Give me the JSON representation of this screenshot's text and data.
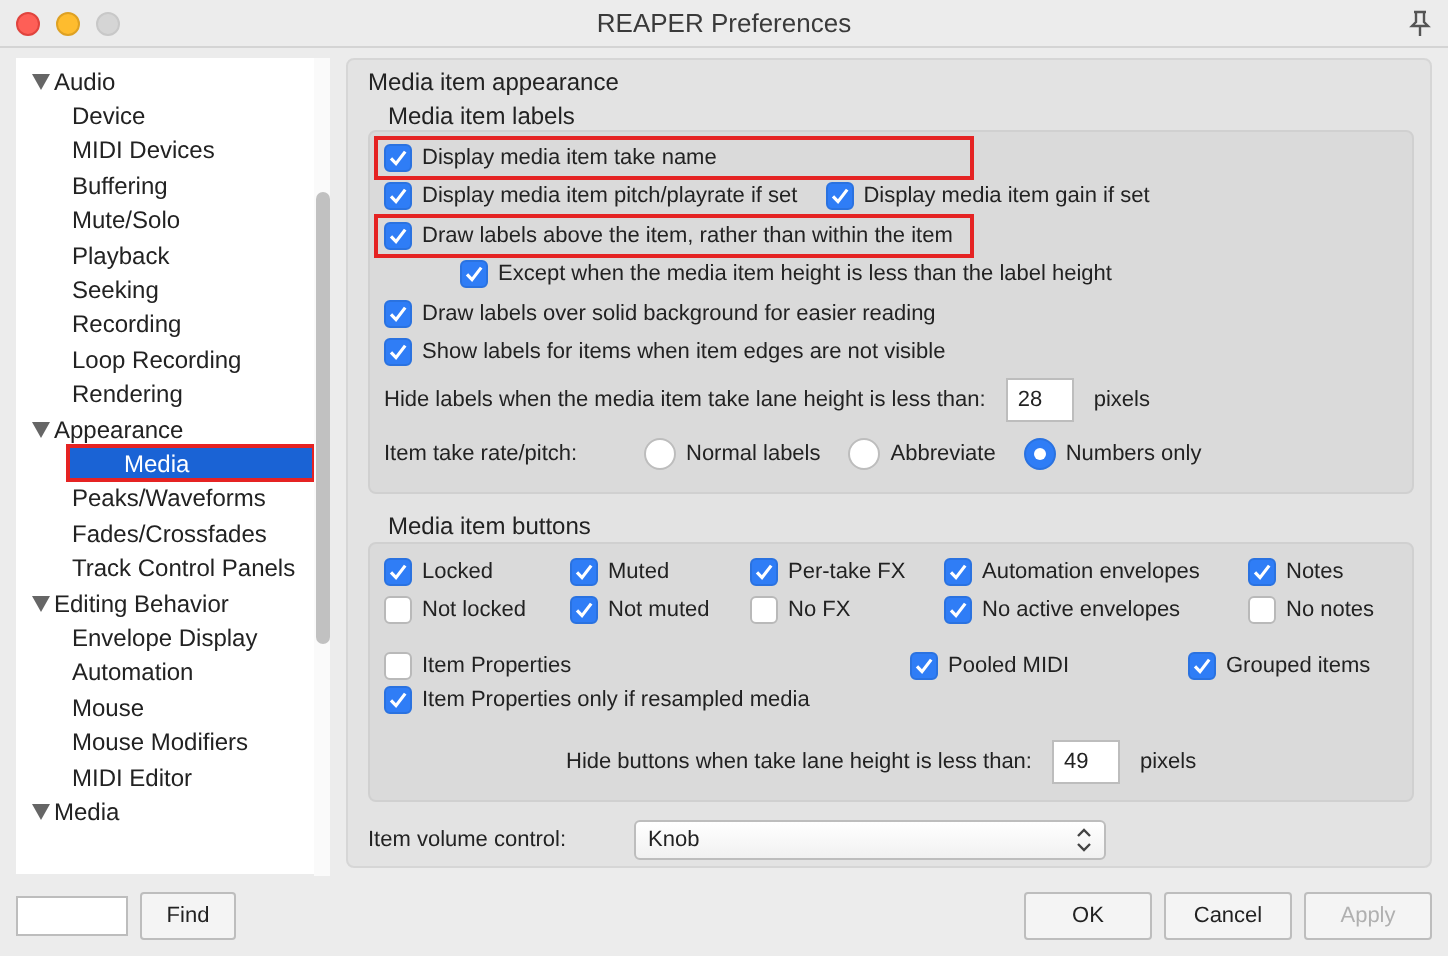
{
  "window": {
    "title": "REAPER Preferences"
  },
  "sidebar": {
    "items": [
      {
        "label": "Audio",
        "expanded": true,
        "selected": false,
        "highlighted": false,
        "children": [
          {
            "label": "Device",
            "selected": false,
            "highlighted": false
          },
          {
            "label": "MIDI Devices",
            "selected": false,
            "highlighted": false
          },
          {
            "label": "Buffering",
            "selected": false,
            "highlighted": false
          },
          {
            "label": "Mute/Solo",
            "selected": false,
            "highlighted": false
          },
          {
            "label": "Playback",
            "selected": false,
            "highlighted": false
          },
          {
            "label": "Seeking",
            "selected": false,
            "highlighted": false
          },
          {
            "label": "Recording",
            "selected": false,
            "highlighted": false
          },
          {
            "label": "Loop Recording",
            "selected": false,
            "highlighted": false
          },
          {
            "label": "Rendering",
            "selected": false,
            "highlighted": false
          }
        ]
      },
      {
        "label": "Appearance",
        "expanded": true,
        "selected": false,
        "highlighted": false,
        "children": [
          {
            "label": "Media",
            "selected": true,
            "highlighted": true
          },
          {
            "label": "Peaks/Waveforms",
            "selected": false,
            "highlighted": false
          },
          {
            "label": "Fades/Crossfades",
            "selected": false,
            "highlighted": false
          },
          {
            "label": "Track Control Panels",
            "selected": false,
            "highlighted": false
          }
        ]
      },
      {
        "label": "Editing Behavior",
        "expanded": true,
        "selected": false,
        "highlighted": false,
        "children": [
          {
            "label": "Envelope Display",
            "selected": false,
            "highlighted": false
          },
          {
            "label": "Automation",
            "selected": false,
            "highlighted": false
          },
          {
            "label": "Mouse",
            "selected": false,
            "highlighted": false
          },
          {
            "label": "Mouse Modifiers",
            "selected": false,
            "highlighted": false
          },
          {
            "label": "MIDI Editor",
            "selected": false,
            "highlighted": false
          }
        ]
      },
      {
        "label": "Media",
        "expanded": true,
        "selected": false,
        "highlighted": false
      }
    ]
  },
  "find_button": "Find",
  "appearance": {
    "title": "Media item appearance",
    "labels": {
      "title": "Media item labels",
      "options": [
        {
          "highlighted": true,
          "checks": [
            {
              "label": "Display media item take name",
              "checked": true
            }
          ]
        },
        {
          "highlighted": false,
          "checks": [
            {
              "label": "Display media item pitch/playrate if set",
              "checked": true
            },
            {
              "label": "Display media item gain if set",
              "checked": true
            }
          ]
        },
        {
          "highlighted": true,
          "checks": [
            {
              "label": "Draw labels above the item, rather than within the item",
              "checked": true
            }
          ],
          "children": [
            {
              "highlighted": false,
              "checks": [
                {
                  "label": "Except when the media item height is less than the label height",
                  "checked": true
                }
              ]
            }
          ]
        },
        {
          "highlighted": false,
          "checks": [
            {
              "label": "Draw labels over solid background for easier reading",
              "checked": true
            }
          ]
        },
        {
          "highlighted": false,
          "checks": [
            {
              "label": "Show labels for items when item edges are not visible",
              "checked": true
            }
          ]
        }
      ],
      "hide_labels": {
        "label": "Hide labels when the media item take lane height is less than:",
        "value": "28",
        "unit": "pixels"
      },
      "rate_pitch": {
        "label": "Item take rate/pitch:",
        "options": [
          {
            "label": "Normal labels",
            "selected": false
          },
          {
            "label": "Abbreviate",
            "selected": false
          },
          {
            "label": "Numbers only",
            "selected": true
          }
        ]
      }
    },
    "buttons": {
      "title": "Media item buttons",
      "grid": [
        {
          "label": "Locked",
          "checked": true
        },
        {
          "label": "Muted",
          "checked": true
        },
        {
          "label": "Per-take FX",
          "checked": true
        },
        {
          "label": "Automation envelopes",
          "checked": true
        },
        {
          "label": "Notes",
          "checked": true
        },
        {
          "label": "Not locked",
          "checked": false
        },
        {
          "label": "Not muted",
          "checked": true
        },
        {
          "label": "No FX",
          "checked": false
        },
        {
          "label": "No active envelopes",
          "checked": true
        },
        {
          "label": "No notes",
          "checked": false
        }
      ],
      "extra": [
        {
          "label": "Item Properties",
          "checked": false
        },
        {
          "label": "Pooled MIDI",
          "checked": true
        },
        {
          "label": "Grouped items",
          "checked": true
        }
      ],
      "resampled": {
        "label": "Item Properties only if resampled media",
        "checked": true
      },
      "hide_buttons": {
        "label": "Hide buttons when take lane height is less than:",
        "value": "49",
        "unit": "pixels"
      }
    },
    "volume": {
      "label": "Item volume control:",
      "value": "Knob"
    }
  },
  "footer_buttons": [
    {
      "label": "OK",
      "disabled": false
    },
    {
      "label": "Cancel",
      "disabled": false
    },
    {
      "label": "Apply",
      "disabled": true
    }
  ]
}
